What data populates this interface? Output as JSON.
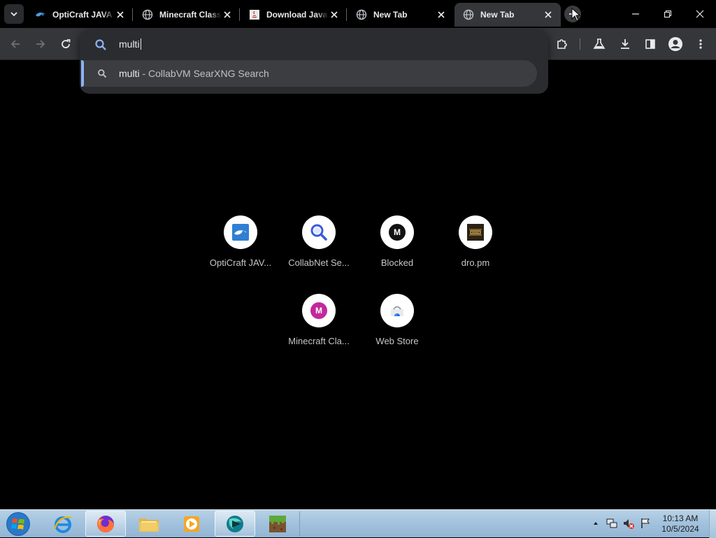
{
  "tabs": [
    {
      "title": "OptiCraft JAVA",
      "icon": "opticraft-icon"
    },
    {
      "title": "Minecraft Classic",
      "icon": "globe-icon"
    },
    {
      "title": "Download Java",
      "icon": "java-icon"
    },
    {
      "title": "New Tab",
      "icon": "globe-icon"
    },
    {
      "title": "New Tab",
      "icon": "globe-icon",
      "active": true
    }
  ],
  "omnibox": {
    "value": "multi",
    "suggestion": {
      "query": "multi",
      "separator": " - ",
      "engine": "CollabVM SearXNG Search"
    }
  },
  "shortcuts": [
    {
      "label": "OptiCraft JAV...",
      "icon": "opticraft-icon"
    },
    {
      "label": "CollabNet Se...",
      "icon": "search-icon"
    },
    {
      "label": "Blocked",
      "icon": "letter-m-dark-icon",
      "letter": "M"
    },
    {
      "label": "dro.pm",
      "icon": "dro-pm-icon"
    },
    {
      "label": "Minecraft Cla...",
      "icon": "letter-m-pink-icon",
      "letter": "M"
    },
    {
      "label": "Web Store",
      "icon": "web-store-icon"
    }
  ],
  "taskbar": {
    "apps": [
      "internet-explorer-icon",
      "firefox-icon",
      "file-explorer-icon",
      "media-player-icon",
      "browser-icon",
      "minecraft-icon"
    ],
    "clock": {
      "time": "10:13 AM",
      "date": "10/5/2024"
    }
  },
  "colors": {
    "accent": "#8ab4f8",
    "toolbar": "#35363a",
    "page_bg": "#000000"
  }
}
